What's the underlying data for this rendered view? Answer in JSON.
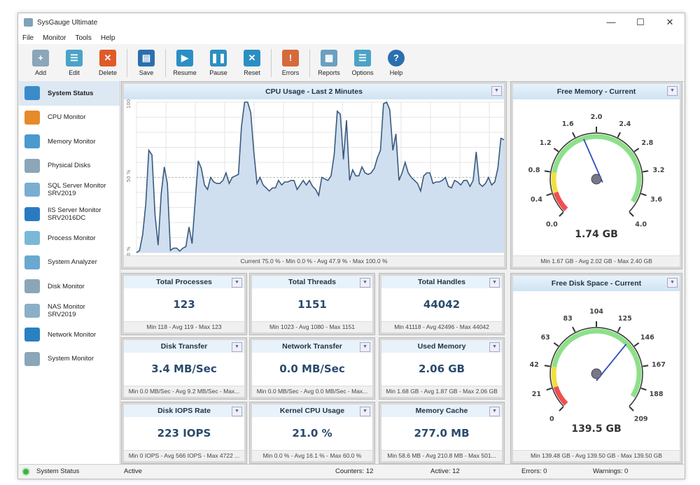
{
  "window": {
    "title": "SysGauge Ultimate",
    "minimize": "—",
    "maximize": "☐",
    "close": "✕"
  },
  "menu": [
    "File",
    "Monitor",
    "Tools",
    "Help"
  ],
  "toolbar": [
    {
      "label": "Add",
      "icon": "add-icon",
      "color": "#8aa6b8"
    },
    {
      "label": "Edit",
      "icon": "edit-icon",
      "color": "#4aa3c8"
    },
    {
      "label": "Delete",
      "icon": "delete-icon",
      "color": "#e05a2a"
    },
    {
      "label": "Save",
      "icon": "save-icon",
      "color": "#2b6fb0"
    },
    {
      "label": "Resume",
      "icon": "play-icon",
      "color": "#2b8fc4"
    },
    {
      "label": "Pause",
      "icon": "pause-icon",
      "color": "#2b8fc4"
    },
    {
      "label": "Reset",
      "icon": "reset-icon",
      "color": "#2b8fc4"
    },
    {
      "label": "Errors",
      "icon": "errors-icon",
      "color": "#d56a3a"
    },
    {
      "label": "Reports",
      "icon": "reports-icon",
      "color": "#6aa0c0"
    },
    {
      "label": "Options",
      "icon": "options-icon",
      "color": "#4aa3c8"
    },
    {
      "label": "Help",
      "icon": "help-icon",
      "color": "#2b6fb0"
    }
  ],
  "sidebar": [
    {
      "label": "System Status",
      "selected": true,
      "color": "#3a8cc8"
    },
    {
      "label": "CPU Monitor",
      "color": "#e88a2a"
    },
    {
      "label": "Memory Monitor",
      "color": "#4a9ad0"
    },
    {
      "label": "Physical Disks",
      "color": "#8aa6b8"
    },
    {
      "label": "SQL Server Monitor",
      "sub": "SRV2019",
      "color": "#7aaed0"
    },
    {
      "label": "IIS Server Monitor",
      "sub": "SRV2016DC",
      "color": "#2a7ac0"
    },
    {
      "label": "Process Monitor",
      "color": "#7ab8d8"
    },
    {
      "label": "System Analyzer",
      "color": "#6aa8d0"
    },
    {
      "label": "Disk Monitor",
      "color": "#8aa6b8"
    },
    {
      "label": "NAS Monitor",
      "sub": "SRV2019",
      "color": "#8ab0c8"
    },
    {
      "label": "Network Monitor",
      "color": "#2a80c0"
    },
    {
      "label": "System Monitor",
      "color": "#8aa6b8"
    }
  ],
  "cpu_panel": {
    "title": "CPU Usage - Last 2 Minutes",
    "footer": "Current 75.0 % - Min 0.0 % - Avg 47.9 % - Max 100.0 %"
  },
  "chart_data": {
    "type": "area",
    "ylim": [
      0,
      100
    ],
    "yticks": [
      "0 %",
      "50 %",
      "100 %"
    ],
    "grid": true,
    "color": "#3b5a7e",
    "fill": "#cfdff0",
    "values": [
      0,
      1.5,
      12,
      32,
      68,
      65,
      25,
      5,
      39,
      57,
      46,
      1.5,
      3,
      3,
      1,
      3,
      4,
      17,
      6,
      34,
      61,
      56,
      45,
      42,
      50,
      47,
      46,
      46,
      48,
      53,
      46,
      50,
      51,
      52,
      84,
      100,
      100,
      93,
      67,
      46,
      50,
      45,
      43,
      41,
      43,
      43,
      48,
      45,
      47,
      47,
      48,
      48,
      42,
      45,
      48,
      45,
      48,
      44,
      42,
      38,
      50,
      49,
      48,
      51,
      65,
      94,
      92,
      62,
      88,
      48,
      55,
      51,
      51,
      57,
      53,
      52,
      53,
      56,
      63,
      68,
      99,
      100,
      95,
      68,
      79,
      48,
      53,
      60,
      53,
      50,
      48,
      46,
      41,
      51,
      53,
      53,
      46,
      47,
      47,
      48,
      50,
      44,
      43,
      48,
      47,
      45,
      48,
      48,
      44,
      48,
      67,
      46,
      44,
      46,
      50,
      45,
      47,
      56,
      76,
      75
    ]
  },
  "gauges": [
    {
      "title": "Free Memory - Current",
      "value": 1.74,
      "value_text": "1.74 GB",
      "min": 0,
      "max": 4,
      "ticks": [
        "0.0",
        "0.4",
        "0.8",
        "1.2",
        "1.6",
        "2.0",
        "2.4",
        "2.8",
        "3.2",
        "3.6",
        "4.0"
      ],
      "zones": [
        {
          "from": 0,
          "to": 0.4,
          "color": "#f05050"
        },
        {
          "from": 0.4,
          "to": 0.8,
          "color": "#f0e040"
        },
        {
          "from": 0.8,
          "to": 3.8,
          "color": "#8ee08a"
        }
      ],
      "footer": "Min 1.67 GB - Avg 2.02 GB - Max 2.40 GB"
    },
    {
      "title": "Free Disk Space - Current",
      "value": 139.5,
      "value_text": "139.5 GB",
      "min": 0,
      "max": 209,
      "ticks": [
        "0",
        "21",
        "42",
        "63",
        "83",
        "104",
        "125",
        "146",
        "167",
        "188",
        "209"
      ],
      "zones": [
        {
          "from": 0,
          "to": 21,
          "color": "#f05050"
        },
        {
          "from": 21,
          "to": 42,
          "color": "#f0e040"
        },
        {
          "from": 42,
          "to": 199,
          "color": "#8ee08a"
        }
      ],
      "footer": "Min 139.48 GB - Avg 139.50 GB - Max 139.50 GB"
    }
  ],
  "tiles": [
    {
      "title": "Total Processes",
      "value": "123",
      "footer": "Min 118 - Avg 119 - Max 123"
    },
    {
      "title": "Total Threads",
      "value": "1151",
      "footer": "Min 1023 - Avg 1080 - Max 1151"
    },
    {
      "title": "Total Handles",
      "value": "44042",
      "footer": "Min 41118 - Avg 42496 - Max 44042"
    },
    {
      "title": "Disk Transfer",
      "value": "3.4 MB/Sec",
      "footer": "Min 0.0 MB/Sec - Avg 9.2 MB/Sec - Max..."
    },
    {
      "title": "Network Transfer",
      "value": "0.0 MB/Sec",
      "footer": "Min 0.0 MB/Sec - Avg 0.0 MB/Sec - Max..."
    },
    {
      "title": "Used Memory",
      "value": "2.06 GB",
      "footer": "Min 1.68 GB - Avg 1.87 GB - Max 2.06 GB"
    },
    {
      "title": "Disk IOPS Rate",
      "value": "223 IOPS",
      "footer": "Min 0 IOPS - Avg 566 IOPS - Max 4722 ..."
    },
    {
      "title": "Kernel CPU Usage",
      "value": "21.0 %",
      "footer": "Min 0.0 % - Avg 16.1 % - Max 60.0 %"
    },
    {
      "title": "Memory Cache",
      "value": "277.0 MB",
      "footer": "Min 58.6 MB - Avg 210.8 MB - Max 501..."
    }
  ],
  "statusbar": {
    "name": "System Status",
    "state": "Active",
    "counters": "Counters: 12",
    "active": "Active: 12",
    "errors": "Errors: 0",
    "warnings": "Warnings: 0",
    "indicator_color": "#3cb043"
  },
  "dropdown_glyph": "▼"
}
